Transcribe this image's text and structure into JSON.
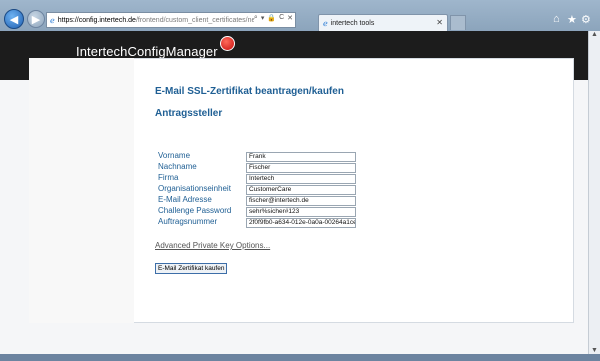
{
  "browser": {
    "url_host": "https://config.intertech.de",
    "url_path": "/frontend/custom_client_certificates/new",
    "address_tools": [
      "⌕",
      "▾",
      "🔒",
      "C",
      "✕"
    ],
    "tab_title": "intertech tools",
    "tab_close": "✕",
    "toolbar_icons": [
      "home-icon",
      "star-icon",
      "gear-icon"
    ]
  },
  "header": {
    "brand": "IntertechConfigManager"
  },
  "main": {
    "title": "E-Mail SSL-Zertifikat beantragen/kaufen",
    "section": "Antragssteller",
    "fields": [
      {
        "label": "Vorname",
        "value": "Frank"
      },
      {
        "label": "Nachname",
        "value": "Fischer"
      },
      {
        "label": "Firma",
        "value": "Intertech"
      },
      {
        "label": "Organisationseinheit",
        "value": "CustomerCare"
      },
      {
        "label": "E-Mail Adresse",
        "value": "fischer@intertech.de"
      },
      {
        "label": "Challenge Password",
        "value": "sehr%sicher#123"
      },
      {
        "label": "Auftragsnummer",
        "value": "2f0f9fb0-a634-012e-0a0a-00264a1ce"
      }
    ],
    "advanced_link": "Advanced Private Key Options...",
    "submit_label": "E-Mail Zertifikat kaufen"
  }
}
